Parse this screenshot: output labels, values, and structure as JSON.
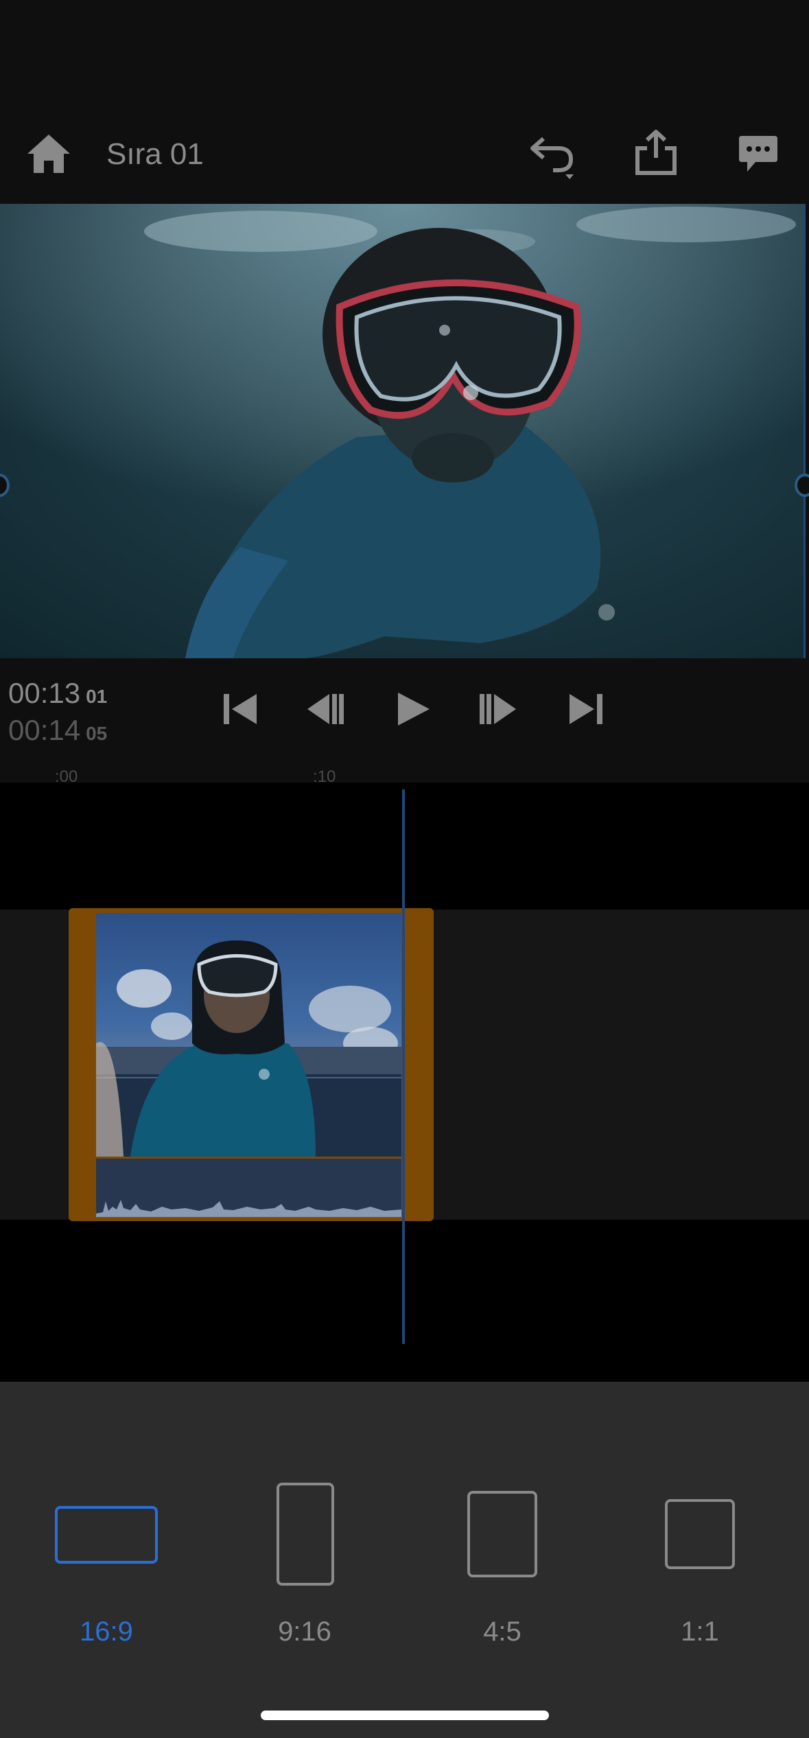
{
  "header": {
    "title": "Sıra 01",
    "icons": [
      "home-icon",
      "undo-icon",
      "share-icon",
      "comment-icon"
    ]
  },
  "playback": {
    "current_time": "00:13",
    "current_frames": "01",
    "total_time": "00:14",
    "total_frames": "05",
    "controls": [
      "skip-to-start-icon",
      "step-back-icon",
      "play-icon",
      "step-forward-icon",
      "skip-to-end-icon"
    ]
  },
  "timeline": {
    "ruler_labels": [
      ":00",
      ":10"
    ]
  },
  "aspect_ratios": {
    "options": [
      {
        "label": "16:9",
        "selected": true
      },
      {
        "label": "9:16",
        "selected": false
      },
      {
        "label": "4:5",
        "selected": false
      },
      {
        "label": "1:1",
        "selected": false
      }
    ]
  },
  "colors": {
    "accent": "#2a6fd6",
    "clip_border": "#7d4a05",
    "playhead": "#23477a"
  }
}
